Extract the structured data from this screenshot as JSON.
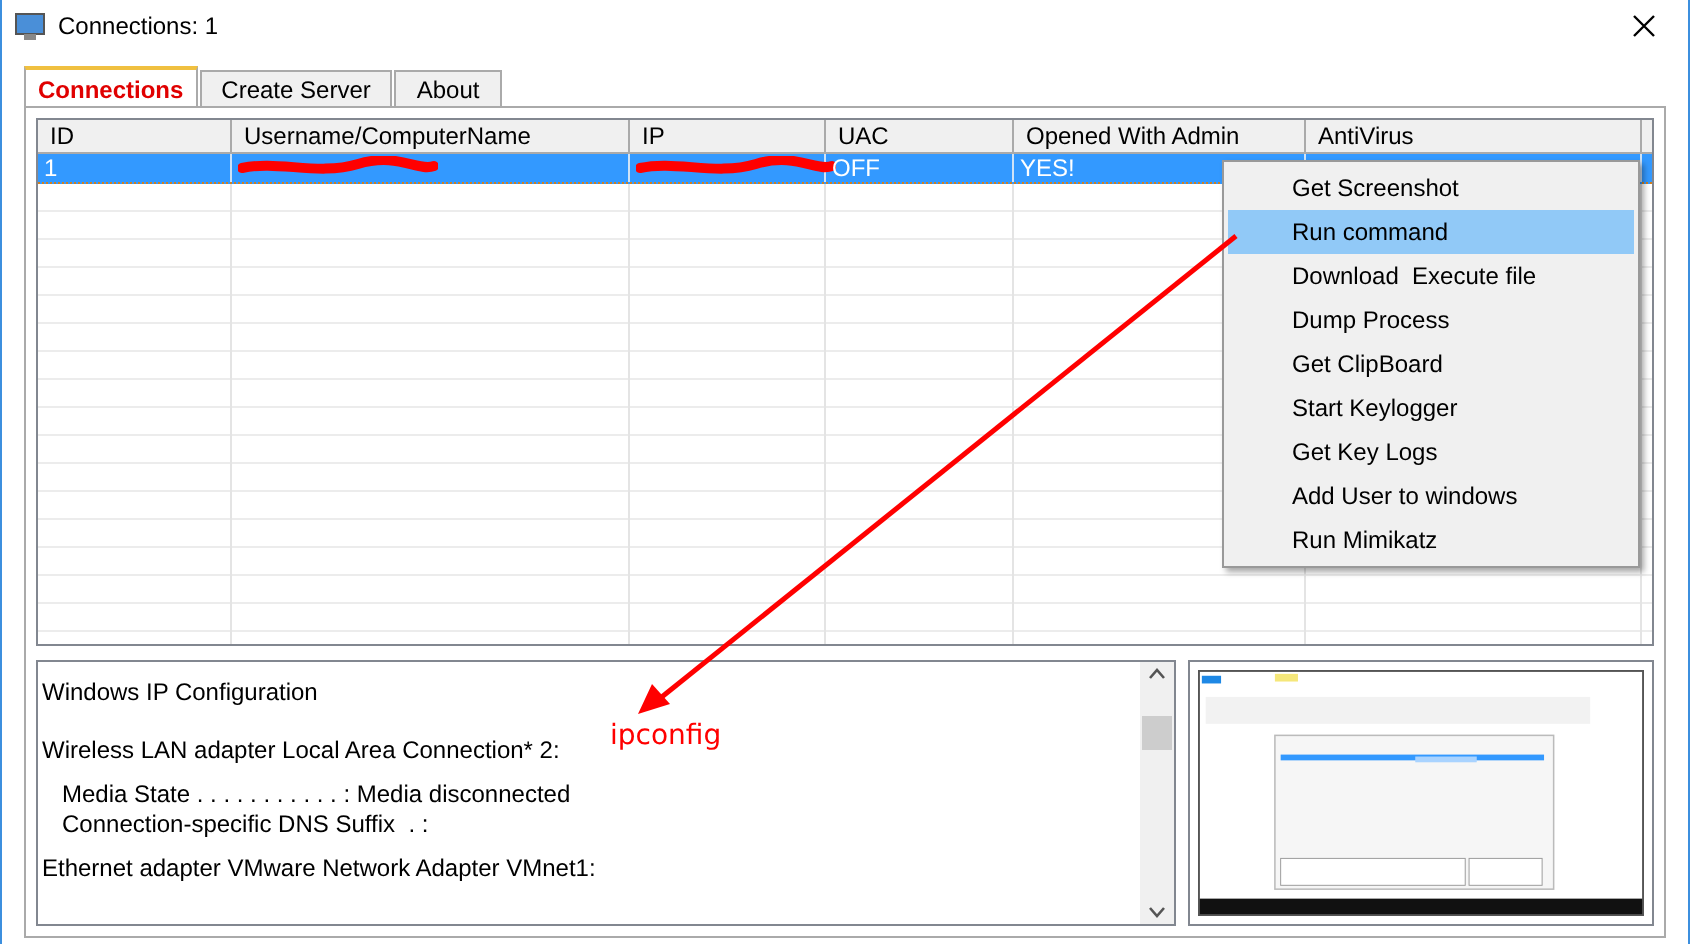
{
  "window": {
    "title": "Connections: 1"
  },
  "tabs": [
    {
      "label": "Connections",
      "selected": true
    },
    {
      "label": "Create Server",
      "selected": false
    },
    {
      "label": "About",
      "selected": false
    }
  ],
  "table": {
    "columns": [
      "ID",
      "Username/ComputerName",
      "IP",
      "UAC",
      "Opened With Admin",
      "AntiVirus"
    ],
    "rows": [
      {
        "selected": true,
        "cells": [
          {
            "kind": "text",
            "text": "1"
          },
          {
            "kind": "redacted"
          },
          {
            "kind": "redacted"
          },
          {
            "kind": "text",
            "text": "OFF"
          },
          {
            "kind": "text",
            "text": "YES!"
          },
          {
            "kind": "hidden"
          }
        ]
      }
    ]
  },
  "context_menu": {
    "items": [
      {
        "label": "Get Screenshot",
        "selected": false
      },
      {
        "label": "Run command",
        "selected": true
      },
      {
        "label": "Download  Execute file",
        "selected": false
      },
      {
        "label": "Dump Process",
        "selected": false
      },
      {
        "label": "Get ClipBoard",
        "selected": false
      },
      {
        "label": "Start Keylogger",
        "selected": false
      },
      {
        "label": "Get Key Logs",
        "selected": false
      },
      {
        "label": "Add User to windows",
        "selected": false
      },
      {
        "label": "Run Mimikatz",
        "selected": false
      }
    ]
  },
  "output": {
    "lines": [
      {
        "kind": "blank"
      },
      {
        "kind": "text",
        "text": "Windows IP Configuration"
      },
      {
        "kind": "blank"
      },
      {
        "kind": "blank"
      },
      {
        "kind": "text",
        "text": "Wireless LAN adapter Local Area Connection* 2:"
      },
      {
        "kind": "blank"
      },
      {
        "kind": "text",
        "text": "   Media State . . . . . . . . . . . : Media disconnected"
      },
      {
        "kind": "text",
        "text": "   Connection-specific DNS Suffix  . :"
      },
      {
        "kind": "blank"
      },
      {
        "kind": "text",
        "text": "Ethernet adapter VMware Network Adapter VMnet1:"
      }
    ]
  },
  "annotation": {
    "label": "ipconfig"
  }
}
